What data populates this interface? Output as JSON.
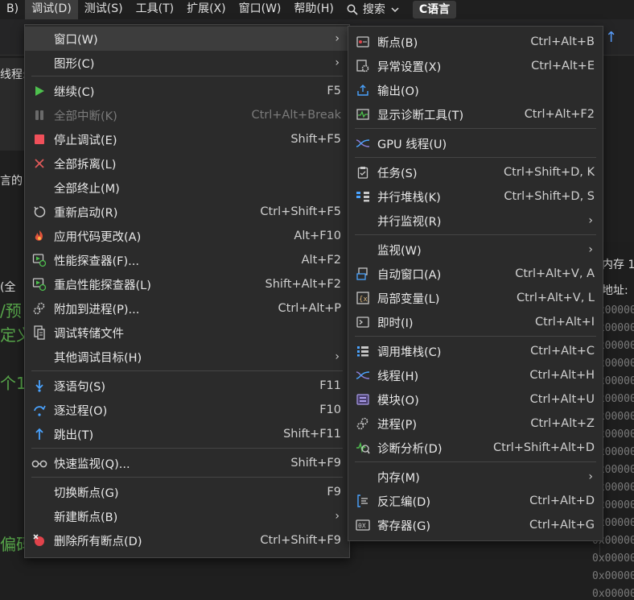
{
  "menubar": {
    "items": [
      "B)",
      "调试(D)",
      "测试(S)",
      "工具(T)",
      "扩展(X)",
      "窗口(W)",
      "帮助(H)"
    ],
    "search_label": "搜索",
    "lang_label": "C语言"
  },
  "background": {
    "thread_label": "线程:",
    "left_fragment_1": "言的",
    "left_fragment_2": "(全",
    "code_1": "/预",
    "code_2": "定义",
    "code_3": "个1",
    "code_4": "偏码",
    "right_title": "内存 1",
    "right_addr": "地址:",
    "hex_rows": [
      "0x00000",
      "0x00000",
      "0x00000",
      "0x00000",
      "0x00000",
      "0x00000",
      "0x00000",
      "0x00000",
      "0x00000",
      "0x00000",
      "0x00000",
      "0x00000",
      "0x00000",
      "0x00000",
      "0x00000",
      "0x00000",
      "0x00000"
    ]
  },
  "debug_menu": [
    {
      "label": "窗口(W)",
      "shortcut": "",
      "arrow": "›"
    },
    {
      "label": "图形(C)",
      "shortcut": "",
      "arrow": "›"
    },
    {
      "label": "继续(C)",
      "shortcut": "F5"
    },
    {
      "label": "全部中断(K)",
      "shortcut": "Ctrl+Alt+Break"
    },
    {
      "label": "停止调试(E)",
      "shortcut": "Shift+F5"
    },
    {
      "label": "全部拆离(L)",
      "shortcut": ""
    },
    {
      "label": "全部终止(M)",
      "shortcut": ""
    },
    {
      "label": "重新启动(R)",
      "shortcut": "Ctrl+Shift+F5"
    },
    {
      "label": "应用代码更改(A)",
      "shortcut": "Alt+F10"
    },
    {
      "label": "性能探查器(F)...",
      "shortcut": "Alt+F2"
    },
    {
      "label": "重启性能探查器(L)",
      "shortcut": "Shift+Alt+F2"
    },
    {
      "label": "附加到进程(P)...",
      "shortcut": "Ctrl+Alt+P"
    },
    {
      "label": "调试转储文件",
      "shortcut": ""
    },
    {
      "label": "其他调试目标(H)",
      "shortcut": "",
      "arrow": "›"
    },
    {
      "label": "逐语句(S)",
      "shortcut": "F11"
    },
    {
      "label": "逐过程(O)",
      "shortcut": "F10"
    },
    {
      "label": "跳出(T)",
      "shortcut": "Shift+F11"
    },
    {
      "label": "快速监视(Q)...",
      "shortcut": "Shift+F9"
    },
    {
      "label": "切换断点(G)",
      "shortcut": "F9"
    },
    {
      "label": "新建断点(B)",
      "shortcut": "",
      "arrow": "›"
    },
    {
      "label": "删除所有断点(D)",
      "shortcut": "Ctrl+Shift+F9"
    }
  ],
  "window_submenu": [
    {
      "label": "断点(B)",
      "shortcut": "Ctrl+Alt+B"
    },
    {
      "label": "异常设置(X)",
      "shortcut": "Ctrl+Alt+E"
    },
    {
      "label": "输出(O)",
      "shortcut": ""
    },
    {
      "label": "显示诊断工具(T)",
      "shortcut": "Ctrl+Alt+F2"
    },
    {
      "label": "GPU 线程(U)",
      "shortcut": ""
    },
    {
      "label": "任务(S)",
      "shortcut": "Ctrl+Shift+D, K"
    },
    {
      "label": "并行堆栈(K)",
      "shortcut": "Ctrl+Shift+D, S"
    },
    {
      "label": "并行监视(R)",
      "shortcut": "",
      "arrow": "›"
    },
    {
      "label": "监视(W)",
      "shortcut": "",
      "arrow": "›"
    },
    {
      "label": "自动窗口(A)",
      "shortcut": "Ctrl+Alt+V, A"
    },
    {
      "label": "局部变量(L)",
      "shortcut": "Ctrl+Alt+V, L"
    },
    {
      "label": "即时(I)",
      "shortcut": "Ctrl+Alt+I"
    },
    {
      "label": "调用堆栈(C)",
      "shortcut": "Ctrl+Alt+C"
    },
    {
      "label": "线程(H)",
      "shortcut": "Ctrl+Alt+H"
    },
    {
      "label": "模块(O)",
      "shortcut": "Ctrl+Alt+U"
    },
    {
      "label": "进程(P)",
      "shortcut": "Ctrl+Alt+Z"
    },
    {
      "label": "诊断分析(D)",
      "shortcut": "Ctrl+Shift+Alt+D"
    },
    {
      "label": "内存(M)",
      "shortcut": "",
      "arrow": "›"
    },
    {
      "label": "反汇编(D)",
      "shortcut": "Ctrl+Alt+D"
    },
    {
      "label": "寄存器(G)",
      "shortcut": "Ctrl+Alt+G"
    }
  ],
  "colors": {
    "continue_green": "#4ec04e",
    "stop_red": "#f0505a",
    "icon_blue": "#4aa3ff",
    "icon_grey": "#c8c8c8",
    "code_green": "#57a64a"
  }
}
